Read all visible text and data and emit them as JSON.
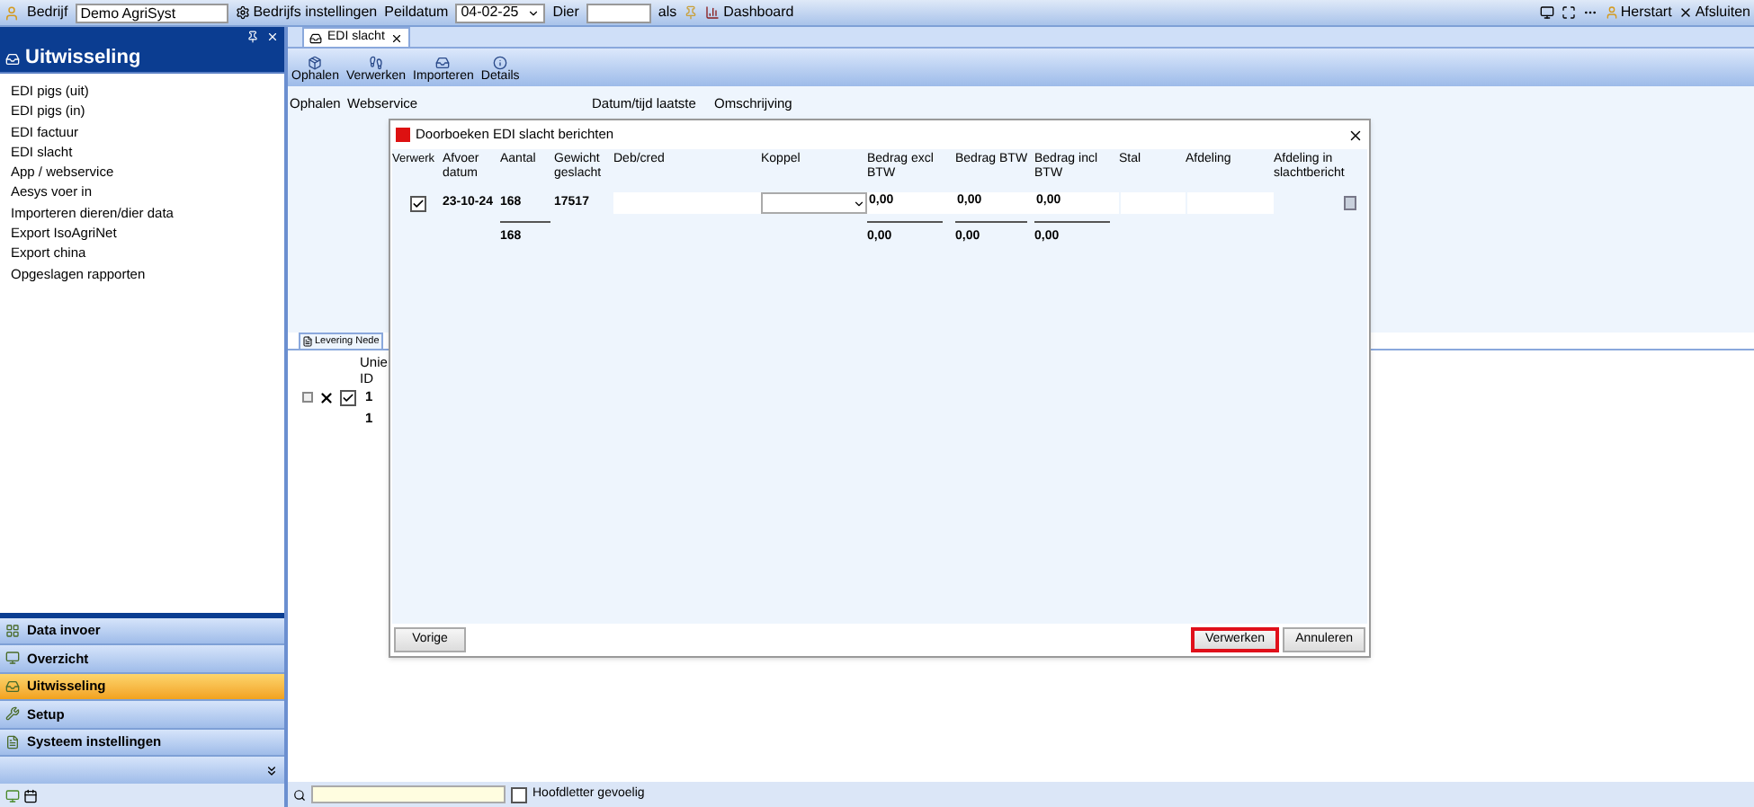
{
  "toolbar": {
    "company_label": "Bedrijf",
    "company_value": "Demo AgriSyst",
    "settings": "Bedrijfs instellingen",
    "date_label": "Peildatum",
    "date_value": "04-02-25",
    "animal_label": "Dier",
    "as_label": "als",
    "dashboard": "Dashboard",
    "restart": "Herstart",
    "close": "Afsluiten"
  },
  "sidebar": {
    "title": "Uitwisseling",
    "items": [
      "EDI pigs (uit)",
      "EDI pigs (in)",
      "EDI factuur",
      "EDI slacht",
      "App / webservice",
      "Aesys voer in",
      "Importeren dieren/dier data",
      "Export IsoAgriNet",
      "Export china",
      "Opgeslagen rapporten"
    ],
    "nav": [
      {
        "label": "Data invoer",
        "selected": false
      },
      {
        "label": "Overzicht",
        "selected": false
      },
      {
        "label": "Uitwisseling",
        "selected": true
      },
      {
        "label": "Setup",
        "selected": false
      },
      {
        "label": "Systeem instellingen",
        "selected": false
      }
    ]
  },
  "main": {
    "tab": "EDI slacht",
    "actions": [
      "Ophalen",
      "Verwerken",
      "Importeren",
      "Details"
    ],
    "columns": [
      "Ophalen",
      "Webservice",
      "Datum/tijd laatste",
      "Omschrijving"
    ],
    "lower_tab": "Levering Nede",
    "lower_column": "Unie ID",
    "lower_rows": [
      {
        "kind": "parent",
        "checked": true,
        "value": "1"
      },
      {
        "kind": "child",
        "value": "1"
      }
    ],
    "search": {
      "case_label": "Hoofdletter gevoelig",
      "checked": false
    }
  },
  "dialog": {
    "title": "Doorboeken EDI slacht berichten",
    "columns": [
      "Verwerk",
      "Afvoer datum",
      "Aantal",
      "Gewicht geslacht",
      "Deb/cred",
      "Koppel",
      "Bedrag excl BTW",
      "Bedrag BTW",
      "Bedrag incl BTW",
      "Stal",
      "Afdeling",
      "Afdeling in slachtbericht"
    ],
    "row": {
      "checked": true,
      "afvoer_datum": "23-10-24",
      "aantal": "168",
      "gewicht": "17517",
      "bedrag_excl": "0,00",
      "bedrag_btw": "0,00",
      "bedrag_incl": "0,00"
    },
    "totals": {
      "aantal": "168",
      "bedrag_excl": "0,00",
      "bedrag_btw": "0,00",
      "bedrag_incl": "0,00"
    },
    "buttons": [
      {
        "label": "Vorige",
        "highlighted": false
      },
      {
        "label": "Verwerken",
        "highlighted": true
      },
      {
        "label": "Annuleren",
        "highlighted": false
      }
    ]
  }
}
